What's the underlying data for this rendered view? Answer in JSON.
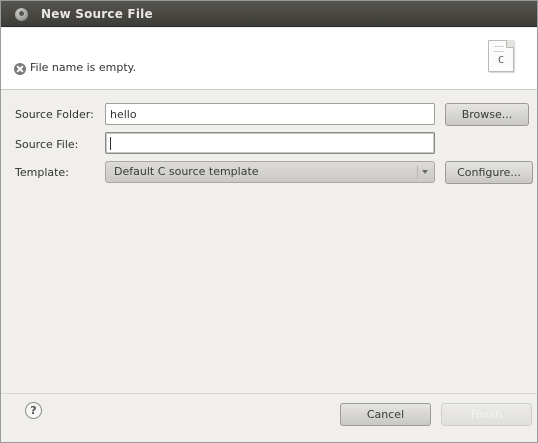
{
  "dialog": {
    "title": "New Source File"
  },
  "header": {
    "message": "File name is empty.",
    "message_icon": "error-icon",
    "file_icon": "c-source-file-icon",
    "file_icon_glyph": "C"
  },
  "form": {
    "source_folder": {
      "label": "Source Folder:",
      "value": "hello",
      "browse_label": "Browse..."
    },
    "source_file": {
      "label": "Source File:",
      "value": ""
    },
    "template": {
      "label": "Template:",
      "selected": "Default C source template",
      "configure_label": "Configure..."
    }
  },
  "footer": {
    "help_symbol": "?",
    "cancel_label": "Cancel",
    "finish_label": "Finish"
  }
}
